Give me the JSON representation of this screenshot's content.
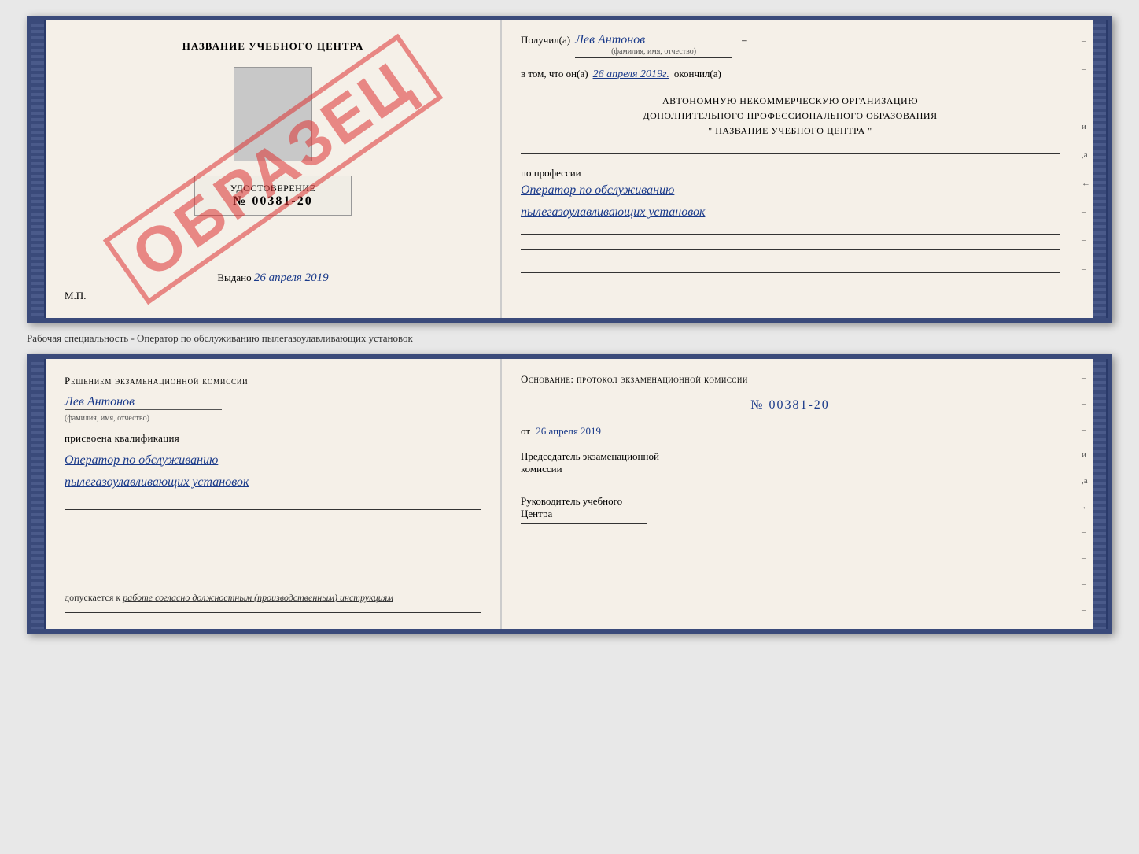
{
  "top_book": {
    "left": {
      "header": "НАЗВАНИЕ УЧЕБНОГО ЦЕНТРА",
      "cert_label": "УДОСТОВЕРЕНИЕ",
      "cert_number": "№ 00381-20",
      "issued_label": "Выдано",
      "issued_date": "26 апреля 2019",
      "mp_label": "М.П.",
      "obrazets": "ОБРАЗЕЦ"
    },
    "right": {
      "received_prefix": "Получил(а)",
      "recipient_name": "Лев Антонов",
      "fio_label": "(фамилия, имя, отчество)",
      "in_that_prefix": "в том, что он(а)",
      "completion_date": "26 апреля 2019г.",
      "finished_label": "окончил(а)",
      "org_line1": "АВТОНОМНУЮ НЕКОММЕРЧЕСКУЮ ОРГАНИЗАЦИЮ",
      "org_line2": "ДОПОЛНИТЕЛЬНОГО ПРОФЕССИОНАЛЬНОГО ОБРАЗОВАНИЯ",
      "org_quote1": "\"",
      "org_name": "НАЗВАНИЕ УЧЕБНОГО ЦЕНТРА",
      "org_quote2": "\"",
      "profession_prefix": "по профессии",
      "profession_line1": "Оператор по обслуживанию",
      "profession_line2": "пылегазоулавливающих установок"
    }
  },
  "middle_label": "Рабочая специальность - Оператор по обслуживанию пылегазоулавливающих установок",
  "bottom_book": {
    "left": {
      "commission_text": "Решением экзаменационной комиссии",
      "person_name": "Лев Антонов",
      "fio_label": "(фамилия, имя, отчество)",
      "assigned_text": "присвоена квалификация",
      "qual_line1": "Оператор по обслуживанию",
      "qual_line2": "пылегазоулавливающих установок",
      "allowed_prefix": "допускается к",
      "allowed_italic": "работе согласно должностным (производственным) инструкциям"
    },
    "right": {
      "basis_text": "Основание: протокол экзаменационной комиссии",
      "protocol_number": "№  00381-20",
      "date_prefix": "от",
      "date_value": "26 апреля 2019",
      "chairman_line1": "Председатель экзаменационной",
      "chairman_line2": "комиссии",
      "head_line1": "Руководитель учебного",
      "head_line2": "Центра"
    }
  },
  "side_marks": [
    "–",
    "–",
    "и",
    ",а",
    "←",
    "–",
    "–",
    "–",
    "–"
  ]
}
